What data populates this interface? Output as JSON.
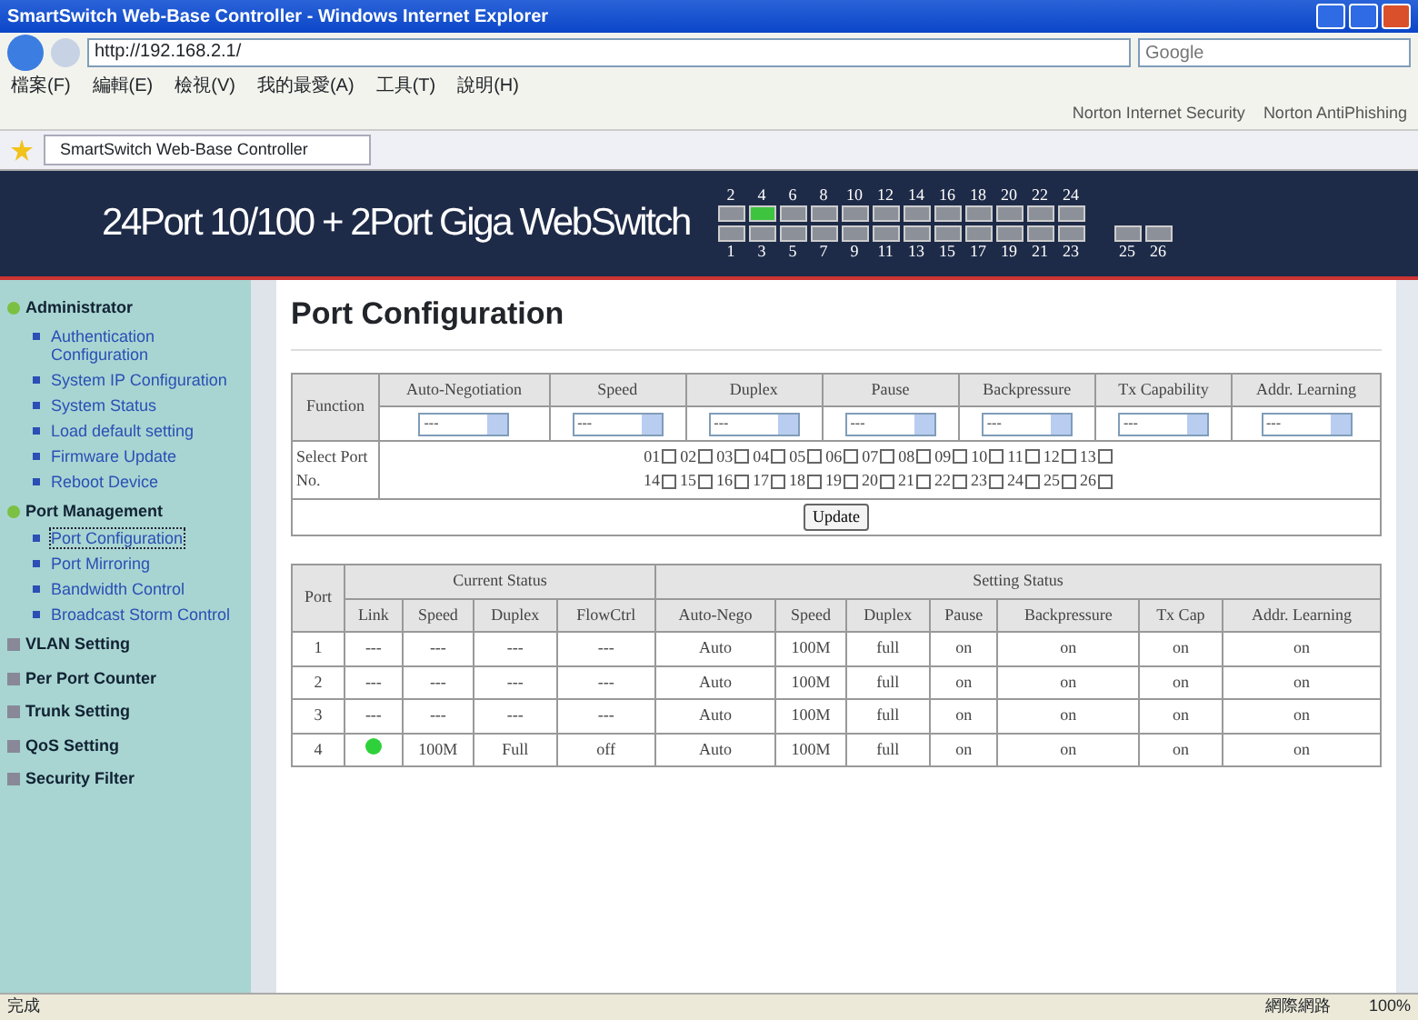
{
  "window": {
    "title": "SmartSwitch Web-Base Controller - Windows Internet Explorer"
  },
  "address_bar": {
    "url": "http://192.168.2.1/",
    "search_placeholder": "Google"
  },
  "menu": [
    "檔案(F)",
    "編輯(E)",
    "檢視(V)",
    "我的最愛(A)",
    "工具(T)",
    "說明(H)"
  ],
  "links_bar": [
    "Norton Internet Security",
    "Norton AntiPhishing"
  ],
  "tab": {
    "title": "SmartSwitch Web-Base Controller"
  },
  "banner": {
    "title": "24Port 10/100 + 2Port Giga WebSwitch",
    "top_ports": [
      {
        "label": "2",
        "link": false
      },
      {
        "label": "4",
        "link": true
      },
      {
        "label": "6",
        "link": false
      },
      {
        "label": "8",
        "link": false
      },
      {
        "label": "10",
        "link": false
      },
      {
        "label": "12",
        "link": false
      },
      {
        "label": "14",
        "link": false
      },
      {
        "label": "16",
        "link": false
      },
      {
        "label": "18",
        "link": false
      },
      {
        "label": "20",
        "link": false
      },
      {
        "label": "22",
        "link": false
      },
      {
        "label": "24",
        "link": false
      }
    ],
    "bottom_ports": [
      {
        "label": "1",
        "link": false
      },
      {
        "label": "3",
        "link": false
      },
      {
        "label": "5",
        "link": false
      },
      {
        "label": "7",
        "link": false
      },
      {
        "label": "9",
        "link": false
      },
      {
        "label": "11",
        "link": false
      },
      {
        "label": "13",
        "link": false
      },
      {
        "label": "15",
        "link": false
      },
      {
        "label": "17",
        "link": false
      },
      {
        "label": "19",
        "link": false
      },
      {
        "label": "21",
        "link": false
      },
      {
        "label": "23",
        "link": false
      }
    ],
    "giga_ports": [
      {
        "label": "25",
        "link": false
      },
      {
        "label": "26",
        "link": false
      }
    ]
  },
  "sidebar": [
    {
      "title": "Administrator",
      "expanded": true,
      "items": [
        {
          "label": "Authentication Configuration",
          "selected": false
        },
        {
          "label": "System IP Configuration",
          "selected": false
        },
        {
          "label": "System Status",
          "selected": false
        },
        {
          "label": "Load default setting",
          "selected": false
        },
        {
          "label": "Firmware Update",
          "selected": false
        },
        {
          "label": "Reboot Device",
          "selected": false
        }
      ]
    },
    {
      "title": "Port Management",
      "expanded": true,
      "items": [
        {
          "label": "Port Configuration",
          "selected": true
        },
        {
          "label": "Port Mirroring",
          "selected": false
        },
        {
          "label": "Bandwidth Control",
          "selected": false
        },
        {
          "label": "Broadcast Storm Control",
          "selected": false
        }
      ]
    },
    {
      "title": "VLAN Setting",
      "expanded": false
    },
    {
      "title": "Per Port Counter",
      "expanded": false
    },
    {
      "title": "Trunk Setting",
      "expanded": false
    },
    {
      "title": "QoS Setting",
      "expanded": false
    },
    {
      "title": "Security Filter",
      "expanded": false
    }
  ],
  "page": {
    "title": "Port Configuration",
    "function_table": {
      "row_label": "Function",
      "columns": [
        {
          "label": "Auto-Negotiation",
          "value": "---"
        },
        {
          "label": "Speed",
          "value": "---"
        },
        {
          "label": "Duplex",
          "value": "---"
        },
        {
          "label": "Pause",
          "value": "---"
        },
        {
          "label": "Backpressure",
          "value": "---"
        },
        {
          "label": "Tx Capability",
          "value": "---"
        },
        {
          "label": "Addr. Learning",
          "value": "---"
        }
      ],
      "select_label": "Select Port No.",
      "ports": [
        {
          "label": "01",
          "checked": false
        },
        {
          "label": "02",
          "checked": false
        },
        {
          "label": "03",
          "checked": false
        },
        {
          "label": "04",
          "checked": false
        },
        {
          "label": "05",
          "checked": false
        },
        {
          "label": "06",
          "checked": false
        },
        {
          "label": "07",
          "checked": false
        },
        {
          "label": "08",
          "checked": false
        },
        {
          "label": "09",
          "checked": false
        },
        {
          "label": "10",
          "checked": false
        },
        {
          "label": "11",
          "checked": false
        },
        {
          "label": "12",
          "checked": false
        },
        {
          "label": "13",
          "checked": false
        },
        {
          "label": "14",
          "checked": false
        },
        {
          "label": "15",
          "checked": false
        },
        {
          "label": "16",
          "checked": false
        },
        {
          "label": "17",
          "checked": false
        },
        {
          "label": "18",
          "checked": false
        },
        {
          "label": "19",
          "checked": false
        },
        {
          "label": "20",
          "checked": false
        },
        {
          "label": "21",
          "checked": false
        },
        {
          "label": "22",
          "checked": false
        },
        {
          "label": "23",
          "checked": false
        },
        {
          "label": "24",
          "checked": false
        },
        {
          "label": "25",
          "checked": false
        },
        {
          "label": "26",
          "checked": false
        }
      ],
      "button": "Update"
    },
    "status_table": {
      "port_header": "Port",
      "current_header": "Current Status",
      "setting_header": "Setting Status",
      "current_columns": [
        "Link",
        "Speed",
        "Duplex",
        "FlowCtrl"
      ],
      "setting_columns": [
        "Auto-Nego",
        "Speed",
        "Duplex",
        "Pause",
        "Backpressure",
        "Tx Cap",
        "Addr. Learning"
      ],
      "rows": [
        {
          "port": "1",
          "link_up": false,
          "current": [
            "---",
            "---",
            "---",
            "---"
          ],
          "setting": [
            "Auto",
            "100M",
            "full",
            "on",
            "on",
            "on",
            "on"
          ]
        },
        {
          "port": "2",
          "link_up": false,
          "current": [
            "---",
            "---",
            "---",
            "---"
          ],
          "setting": [
            "Auto",
            "100M",
            "full",
            "on",
            "on",
            "on",
            "on"
          ]
        },
        {
          "port": "3",
          "link_up": false,
          "current": [
            "---",
            "---",
            "---",
            "---"
          ],
          "setting": [
            "Auto",
            "100M",
            "full",
            "on",
            "on",
            "on",
            "on"
          ]
        },
        {
          "port": "4",
          "link_up": true,
          "current": [
            "100M",
            "Full",
            "off"
          ],
          "setting": [
            "Auto",
            "100M",
            "full",
            "on",
            "on",
            "on",
            "on"
          ]
        }
      ]
    }
  },
  "status_bar": {
    "status": "完成",
    "zone": "網際網路",
    "zoom": "100%"
  }
}
